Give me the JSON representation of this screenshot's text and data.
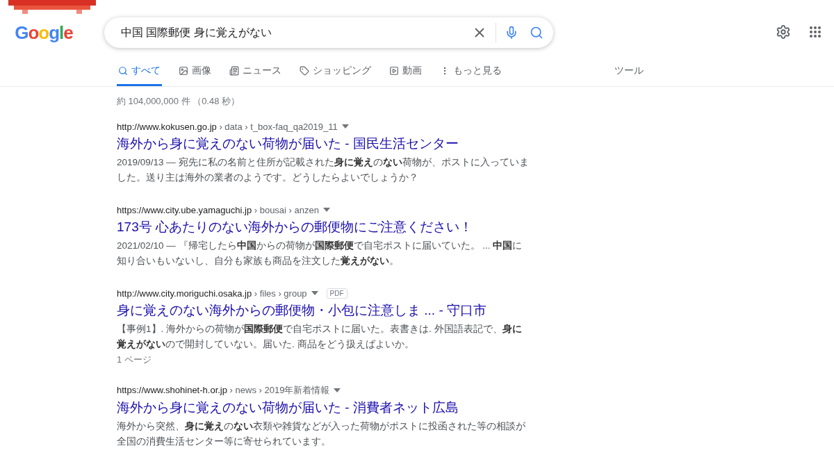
{
  "logo": {
    "text": "Google"
  },
  "search": {
    "value": "中国 国際郵便 身に覚えがない"
  },
  "tabs": [
    {
      "label": "すべて",
      "kind": "search",
      "selected": true
    },
    {
      "label": "画像",
      "kind": "image",
      "selected": false
    },
    {
      "label": "ニュース",
      "kind": "news",
      "selected": false
    },
    {
      "label": "ショッピング",
      "kind": "tag",
      "selected": false
    },
    {
      "label": "動画",
      "kind": "video",
      "selected": false
    },
    {
      "label": "もっと見る",
      "kind": "more",
      "selected": false
    }
  ],
  "tools": "ツール",
  "stats": "約 104,000,000 件 （0.48 秒）",
  "results": [
    {
      "domain": "http://www.kokusen.go.jp",
      "path": " › data › t_box-faq_qa2019_11",
      "title": "海外から身に覚えのない荷物が届いた - 国民生活センター",
      "snippet": "2019/09/13 — 宛先に私の名前と住所が記載された**身に覚え**の**ない**荷物が、ポストに入っていました。送り主は海外の業者のようです。どうしたらよいでしょうか？"
    },
    {
      "domain": "https://www.city.ube.yamaguchi.jp",
      "path": " › bousai › anzen",
      "title": "173号 心あたりのない海外からの郵便物にご注意ください！",
      "snippet": "2021/02/10 — 『帰宅したら**中国**からの荷物が**国際郵便**で自宅ポストに届いていた。 ... **中国**に知り合いもいないし、自分も家族も商品を注文した**覚えがない**。"
    },
    {
      "domain": "http://www.city.moriguchi.osaka.jp",
      "path": " › files › group",
      "badge": "PDF",
      "title": "身に覚えのない海外からの郵便物・小包に注意しま ... - 守口市",
      "snippet": "【事例1】. 海外からの荷物が**国際郵便**で自宅ポストに届いた。表書きは. 外国語表記で、**身に覚えがない**ので開封していない。届いた. 商品をどう扱えばよいか。",
      "pages": "1 ページ"
    },
    {
      "domain": "https://www.shohinet-h.or.jp",
      "path": " › news › 2019年新着情報",
      "title": "海外から身に覚えのない荷物が届いた - 消費者ネット広島",
      "snippet": "海外から突然、**身に覚え**の**ない**衣類や雑貨などが入った荷物がポストに投函された等の相談が全国の消費生活センター等に寄せられています。"
    }
  ]
}
